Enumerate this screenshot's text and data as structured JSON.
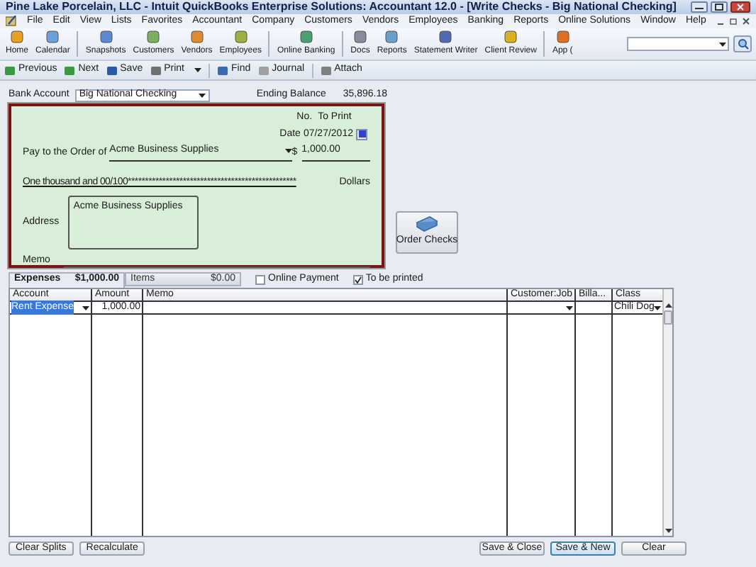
{
  "window": {
    "title": "Pine Lake Porcelain, LLC  - Intuit QuickBooks Enterprise Solutions: Accountant 12.0 - [Write Checks - Big National Checking]"
  },
  "menu": [
    "File",
    "Edit",
    "View",
    "Lists",
    "Favorites",
    "Accountant",
    "Company",
    "Customers",
    "Vendors",
    "Employees",
    "Banking",
    "Reports",
    "Online Solutions",
    "Window",
    "Help"
  ],
  "toolbar": [
    {
      "label": "Home"
    },
    {
      "label": "Calendar"
    },
    {
      "label": "Snapshots",
      "group_start": true
    },
    {
      "label": "Customers"
    },
    {
      "label": "Vendors"
    },
    {
      "label": "Employees"
    },
    {
      "label": "Online Banking",
      "group_start": true
    },
    {
      "label": "Docs",
      "group_start": true
    },
    {
      "label": "Reports"
    },
    {
      "label": "Statement Writer"
    },
    {
      "label": "Client Review"
    },
    {
      "label": "App (",
      "group_start": true
    }
  ],
  "form_toolbar": [
    {
      "label": "Previous"
    },
    {
      "label": "Next"
    },
    {
      "label": "Save"
    },
    {
      "label": "Print",
      "dropdown": true
    },
    {
      "label": "Find",
      "group_start": true
    },
    {
      "label": "Journal"
    },
    {
      "label": "Attach",
      "group_start": true
    }
  ],
  "bank_account": {
    "label": "Bank Account",
    "value": "Big National Checking"
  },
  "ending_balance": {
    "label": "Ending Balance",
    "value": "35,896.18"
  },
  "check": {
    "no_label": "No.",
    "no_value": "To Print",
    "date_label": "Date",
    "date": "07/27/2012",
    "pay_to_label": "Pay to the Order of",
    "payee": "Acme Business Supplies",
    "dollar_sign": "$",
    "amount": "1,000.00",
    "amount_words": "One thousand  and 00/100*************************************************",
    "dollars_label": "Dollars",
    "address_label": "Address",
    "address": "Acme Business Supplies",
    "memo_label": "Memo"
  },
  "order_checks": "Order Checks",
  "tabs": [
    {
      "label": "Expenses",
      "amount": "$1,000.00",
      "selected": true
    },
    {
      "label": "Items",
      "amount": "$0.00",
      "selected": false
    }
  ],
  "checkboxes": [
    {
      "label": "Online Payment",
      "checked": false
    },
    {
      "label": "To be printed",
      "checked": true
    }
  ],
  "table": {
    "columns": [
      "Account",
      "Amount",
      "Memo",
      "Customer:Job",
      "Billa...",
      "Class"
    ],
    "rows": [
      {
        "cells": [
          "Rent Expense",
          "1,000.00",
          "",
          "",
          "",
          "Chili Dog"
        ],
        "selected": true
      }
    ]
  },
  "buttons_left": [
    "Clear Splits",
    "Recalculate"
  ],
  "buttons_right": [
    {
      "label": "Save & Close",
      "default": false
    },
    {
      "label": "Save & New",
      "default": true
    },
    {
      "label": "Clear",
      "default": false
    }
  ]
}
